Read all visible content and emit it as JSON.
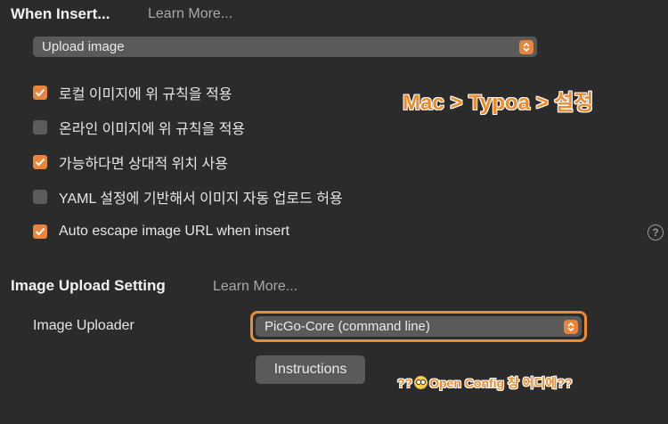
{
  "when_insert": {
    "title": "When Insert...",
    "learn_more": "Learn More...",
    "select_value": "Upload image",
    "options": [
      {
        "label": "로컬 이미지에 위 규칙을 적용",
        "checked": true
      },
      {
        "label": "온라인 이미지에 위 규칙을 적용",
        "checked": false
      },
      {
        "label": "가능하다면 상대적 위치 사용",
        "checked": true
      },
      {
        "label": "YAML 설정에 기반해서 이미지 자동 업로드 허용",
        "checked": false
      },
      {
        "label": "Auto escape image URL when insert",
        "checked": true
      }
    ],
    "help": "?"
  },
  "upload_setting": {
    "title": "Image Upload Setting",
    "learn_more": "Learn More...",
    "uploader_label": "Image Uploader",
    "uploader_value": "PicGo-Core (command line)",
    "instructions_label": "Instructions"
  },
  "annotations": {
    "path": "Mac > Typoa > 설정",
    "question_prefix": "??",
    "question_text": "Open Config 창 어디에??"
  },
  "colors": {
    "accent": "#e8853a",
    "annotation": "#f08b2c",
    "background": "#2b2b2b"
  }
}
